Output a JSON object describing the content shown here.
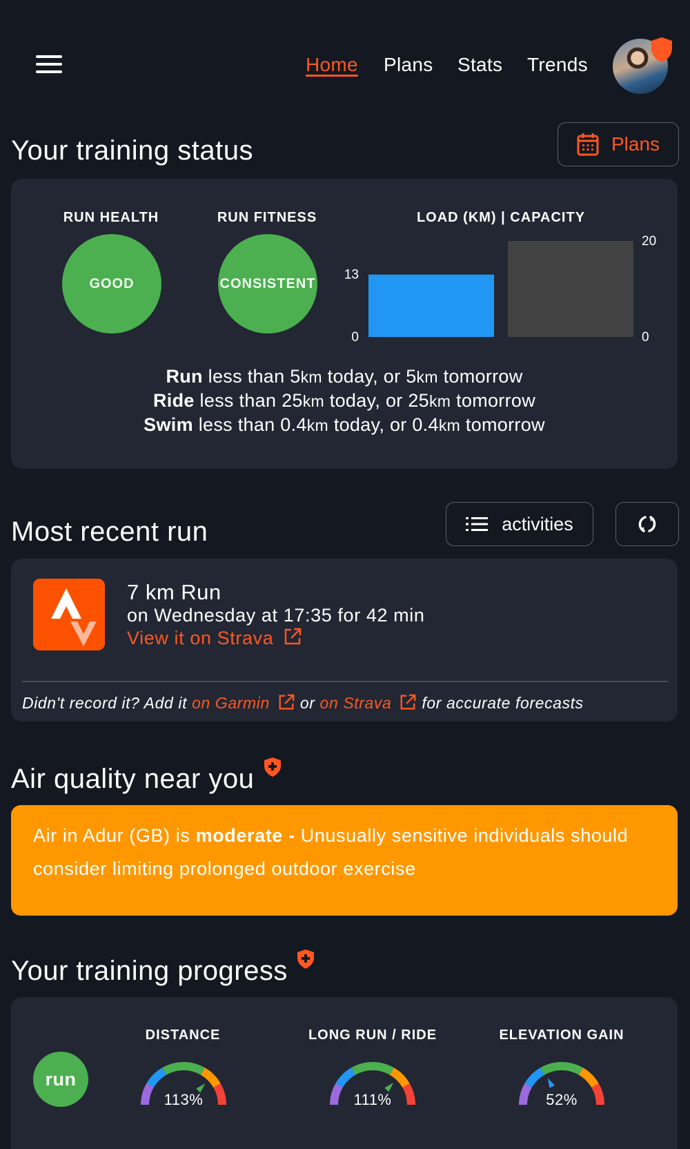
{
  "nav": {
    "items": [
      {
        "label": "Home",
        "active": true
      },
      {
        "label": "Plans",
        "active": false
      },
      {
        "label": "Stats",
        "active": false
      },
      {
        "label": "Trends",
        "active": false
      }
    ]
  },
  "training_status": {
    "title": "Your training status",
    "plans_button": "Plans",
    "run_health": {
      "label": "RUN HEALTH",
      "value": "GOOD"
    },
    "run_fitness": {
      "label": "RUN FITNESS",
      "value": "CONSISTENT"
    },
    "load_capacity": {
      "label": "LOAD (KM) | CAPACITY",
      "load": 13,
      "capacity": 20,
      "load_axis_min": "0",
      "load_axis_label": "13",
      "capacity_axis_max": "20",
      "capacity_axis_min": "0"
    },
    "advice": [
      {
        "sport": "Run",
        "text1": "less than 5",
        "unit1": "km",
        "text2": "today, or 5",
        "unit2": "km",
        "text3": "tomorrow"
      },
      {
        "sport": "Ride",
        "text1": "less than 25",
        "unit1": "km",
        "text2": "today, or 25",
        "unit2": "km",
        "text3": "tomorrow"
      },
      {
        "sport": "Swim",
        "text1": "less than 0.4",
        "unit1": "km",
        "text2": "today, or 0.4",
        "unit2": "km",
        "text3": "tomorrow"
      }
    ]
  },
  "recent_run": {
    "title": "Most recent run",
    "activities_button": "activities",
    "activity_title": "7 km Run",
    "activity_subtitle": "on Wednesday at 17:35 for 42 min",
    "strava_link": "View it on Strava",
    "footer": {
      "prefix": "Didn't record it? Add it",
      "garmin_link": "on Garmin",
      "middle": "or",
      "strava_link": "on Strava",
      "suffix": "for accurate forecasts"
    }
  },
  "air_quality": {
    "title": "Air quality near you",
    "text_prefix": "Air in Adur (GB) is",
    "level": "moderate -",
    "text_suffix": "Unusually sensitive individuals should consider limiting prolonged outdoor exercise",
    "color": "#ff9800"
  },
  "training_progress": {
    "title": "Your training progress",
    "sport_badge": "run",
    "gauges": [
      {
        "label": "DISTANCE",
        "value_text": "113%",
        "value": 113
      },
      {
        "label": "LONG RUN / RIDE",
        "value_text": "111%",
        "value": 111
      },
      {
        "label": "ELEVATION GAIN",
        "value_text": "52%",
        "value": 52
      }
    ]
  },
  "colors": {
    "accent": "#ff5722",
    "good": "#4caf50",
    "load_bar": "#2196f3",
    "capacity_bar": "#424242",
    "background": "#141820",
    "card": "#222733"
  }
}
